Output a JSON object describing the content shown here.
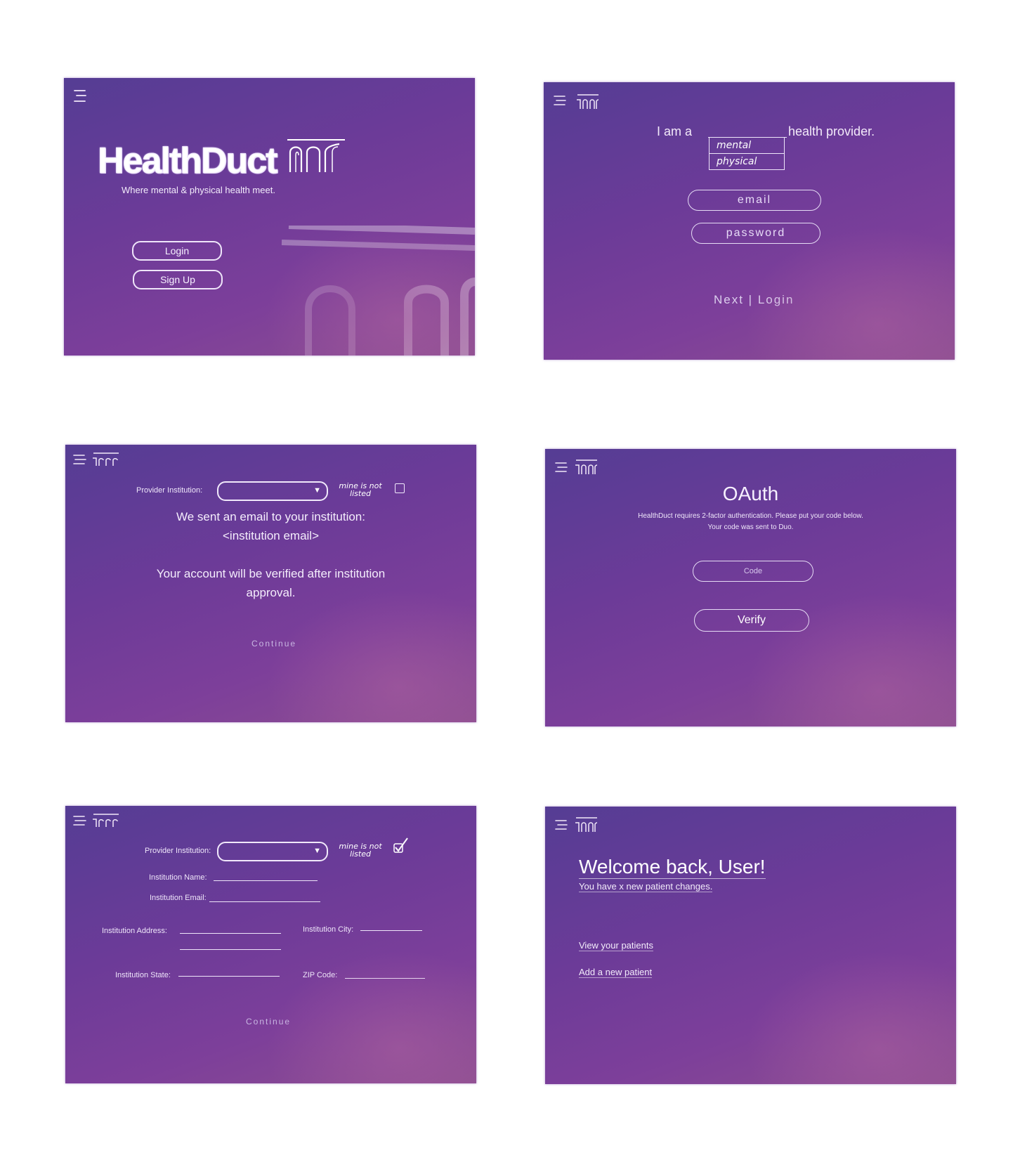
{
  "screens": {
    "landing": {
      "brand": "HealthDuct",
      "tagline": "Where mental & physical health meet.",
      "login_label": "Login",
      "signup_label": "Sign Up"
    },
    "provider_login": {
      "prefix": "I am a",
      "suffix": "health provider.",
      "options": [
        "mental",
        "physical"
      ],
      "email_placeholder": "email",
      "password_placeholder": "password",
      "next_login": "Next | Login"
    },
    "institution_sent": {
      "provider_label": "Provider Institution:",
      "not_listed_note": "mine is not listed",
      "message_line1": "We sent an email to your institution:",
      "message_line2": "<institution email>",
      "message_line3": "Your account will be verified after institution",
      "message_line4": "approval.",
      "continue_label": "Continue"
    },
    "oauth": {
      "title": "OAuth",
      "text_line1": "HealthDuct requires 2-factor authentication. Please put your code below.",
      "text_line2": "Your code was sent to Duo.",
      "code_placeholder": "Code",
      "verify_label": "Verify"
    },
    "institution_form": {
      "provider_label": "Provider Institution:",
      "not_listed_note": "mine is not listed",
      "name_label": "Institution Name:",
      "email_label": "Institution Email:",
      "address_label": "Institution Address:",
      "city_label": "Institution City:",
      "state_label": "Institution State:",
      "zip_label": "ZIP Code:",
      "continue_label": "Continue"
    },
    "dashboard": {
      "welcome": "Welcome back, User!",
      "changes": "You have x new patient changes.",
      "view_patients": "View your patients",
      "add_patient": "Add a new patient"
    }
  },
  "colors": {
    "gradient_start": "#553d94",
    "gradient_end": "#8e4f91",
    "text": "#f3eafa",
    "background": "#ffffff"
  },
  "icons": [
    "menu-icon",
    "healthduct-logo-icon",
    "dropdown-caret-icon",
    "checkbox-icon",
    "checked-checkbox-icon"
  ]
}
